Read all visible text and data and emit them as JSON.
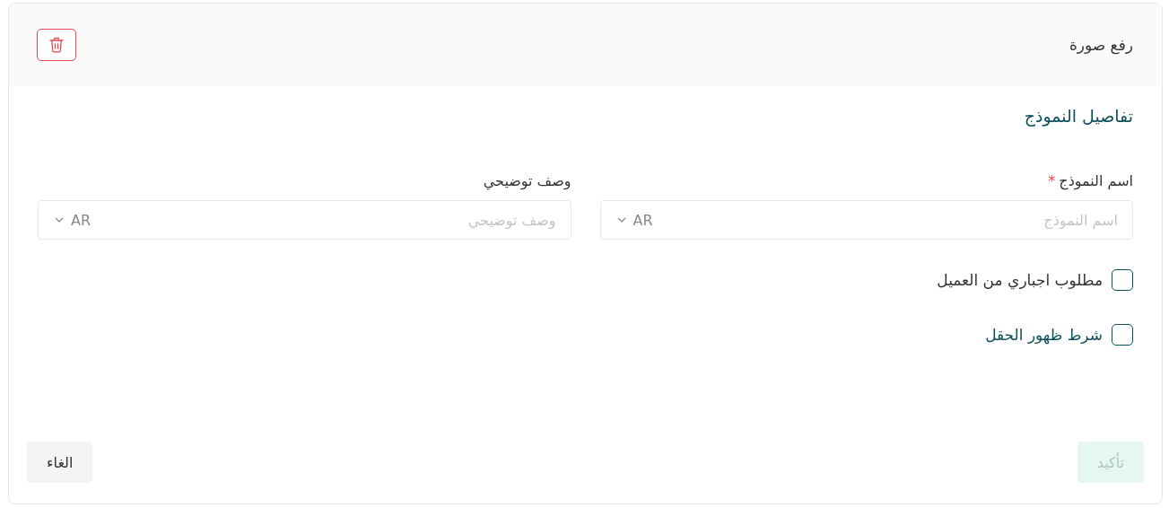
{
  "header": {
    "title": "رفع صورة"
  },
  "section": {
    "title": "تفاصيل النموذج"
  },
  "fields": [
    {
      "label": "اسم النموذج",
      "required_mark": "*",
      "placeholder": "اسم النموذج",
      "language": "AR"
    },
    {
      "label": "وصف توضيحي",
      "placeholder": "وصف توضيحي",
      "language": "AR"
    }
  ],
  "checkboxes": [
    {
      "label": "مطلوب اجباري من العميل",
      "checked": false,
      "kind": "plain"
    },
    {
      "label": "شرط ظهور الحقل",
      "checked": false,
      "kind": "accent"
    }
  ],
  "buttons": [
    {
      "label": "تأكيد",
      "kind": "primary",
      "disabled": true
    },
    {
      "label": "الغاء",
      "kind": "secondary",
      "disabled": false
    }
  ]
}
